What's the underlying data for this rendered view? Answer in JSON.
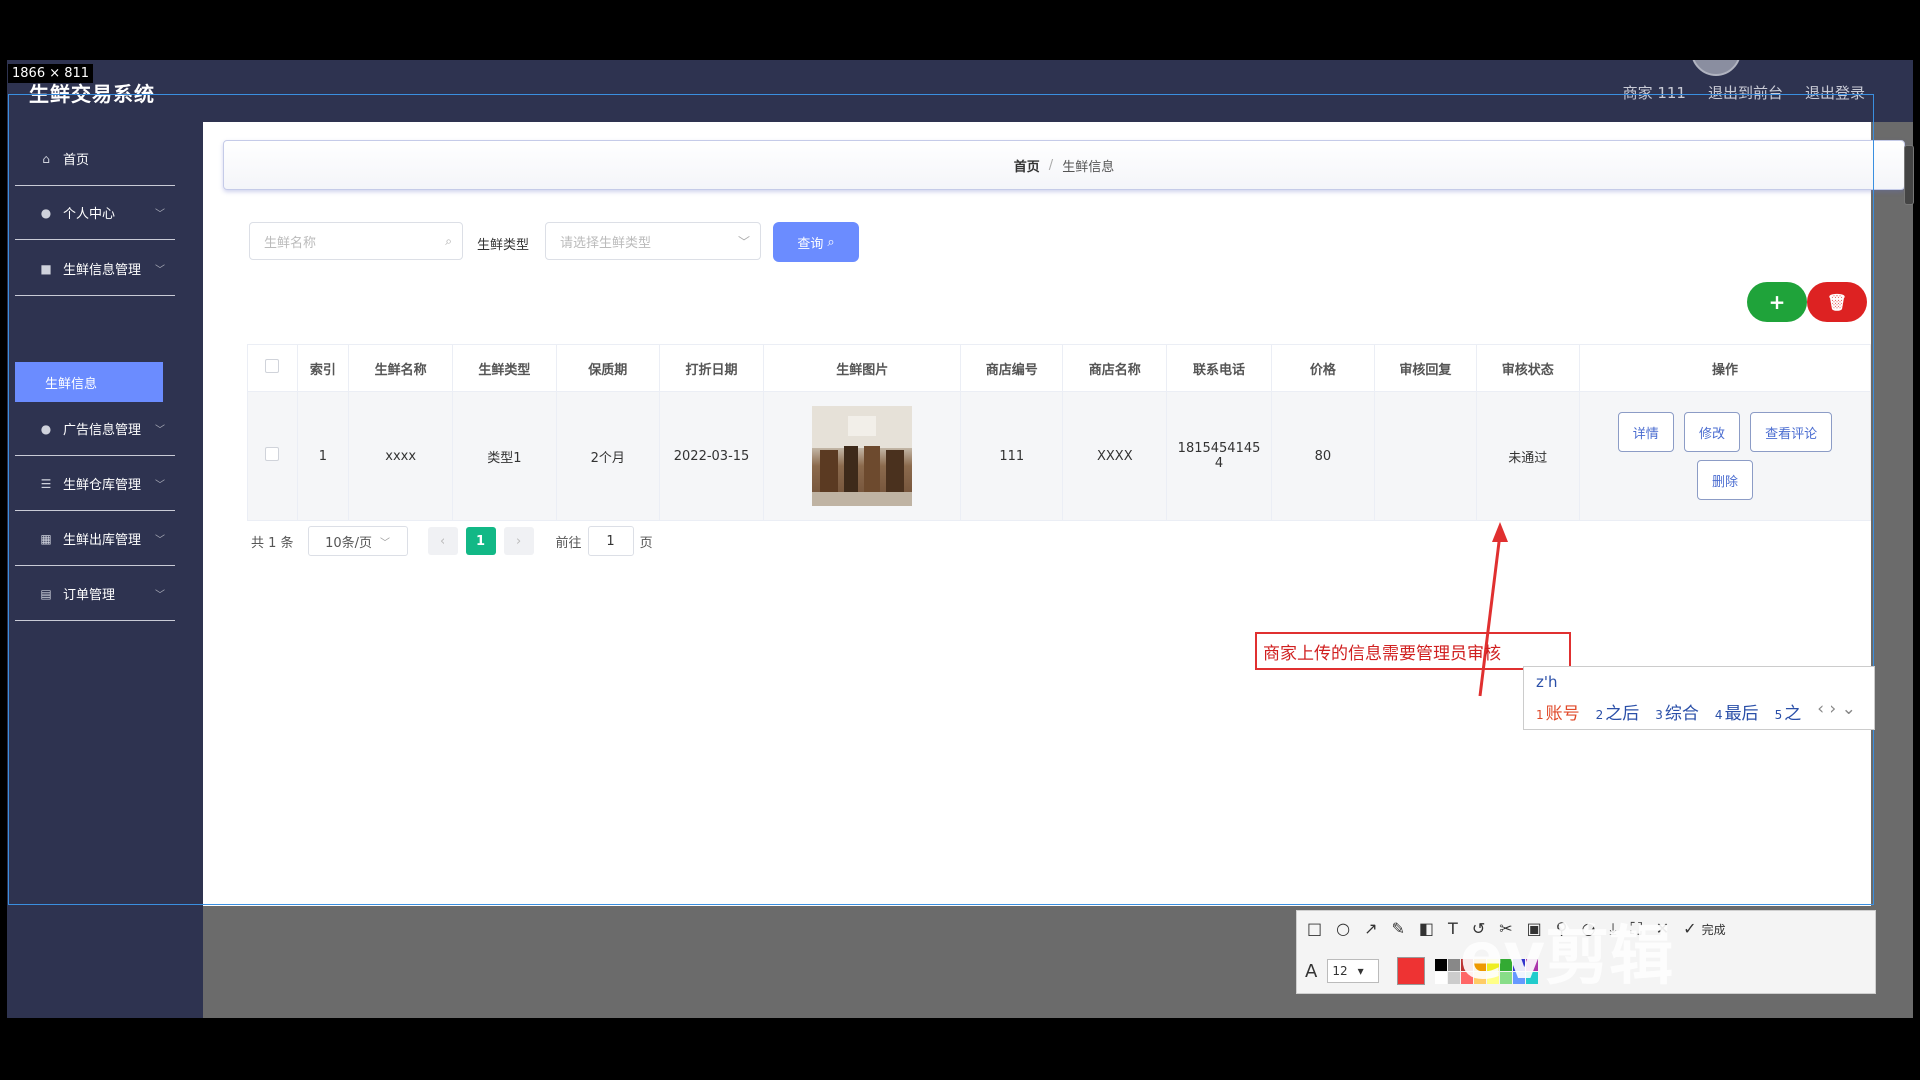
{
  "capture": {
    "size_label": "1866 × 811"
  },
  "header": {
    "app_title": "生鲜交易系统",
    "links": [
      "商家 111",
      "退出到前台",
      "退出登录"
    ]
  },
  "sidebar": {
    "items": [
      {
        "label": "首页",
        "icon": "home-icon",
        "expandable": false
      },
      {
        "label": "个人中心",
        "icon": "user-icon",
        "expandable": true
      },
      {
        "label": "生鲜信息管理",
        "icon": "box-icon",
        "expandable": true
      },
      {
        "label": "广告信息管理",
        "icon": "user-icon",
        "expandable": true
      },
      {
        "label": "生鲜仓库管理",
        "icon": "list-icon",
        "expandable": true
      },
      {
        "label": "生鲜出库管理",
        "icon": "grid-icon",
        "expandable": true
      },
      {
        "label": "订单管理",
        "icon": "doc-icon",
        "expandable": true
      }
    ],
    "active_sub": "生鲜信息"
  },
  "breadcrumb": {
    "home": "首页",
    "sep": "/",
    "current": "生鲜信息"
  },
  "search": {
    "name_placeholder": "生鲜名称",
    "type_label": "生鲜类型",
    "type_placeholder": "请选择生鲜类型",
    "button_label": "查询"
  },
  "actions": {
    "add_symbol": "+",
    "delete_symbol": "🗑",
    "add_color": "#1fa33a",
    "delete_color": "#dd2222"
  },
  "table": {
    "columns": [
      "索引",
      "生鲜名称",
      "生鲜类型",
      "保质期",
      "打折日期",
      "生鲜图片",
      "商店编号",
      "商店名称",
      "联系电话",
      "价格",
      "审核回复",
      "审核状态",
      "操作"
    ],
    "rows": [
      {
        "index": "1",
        "name": "xxxx",
        "type": "类型1",
        "shelf_life": "2个月",
        "discount_date": "2022-03-15",
        "shop_no": "111",
        "shop_name": "XXXX",
        "phone_line1": "1815454145",
        "phone_line2": "4",
        "price": "80",
        "reply": "",
        "status": "未通过",
        "ops": {
          "detail": "详情",
          "edit": "修改",
          "review": "查看评论",
          "delete": "删除"
        }
      }
    ]
  },
  "pager": {
    "total": "共 1 条",
    "page_size": "10条/页",
    "current_page": "1",
    "goto_label": "前往",
    "goto_value": "1",
    "page_suffix": "页"
  },
  "annotation": {
    "text": "商家上传的信息需要管理员审核"
  },
  "ime": {
    "composition": "z'h",
    "candidates": [
      {
        "num": "1",
        "text": "账号"
      },
      {
        "num": "2",
        "text": "之后"
      },
      {
        "num": "3",
        "text": "综合"
      },
      {
        "num": "4",
        "text": "最后"
      },
      {
        "num": "5",
        "text": "之"
      }
    ]
  },
  "capture_toolbar": {
    "done_label": "完成",
    "font_size": "12",
    "selected_color": "#ee3333"
  },
  "watermark": {
    "text": "ev剪辑"
  }
}
